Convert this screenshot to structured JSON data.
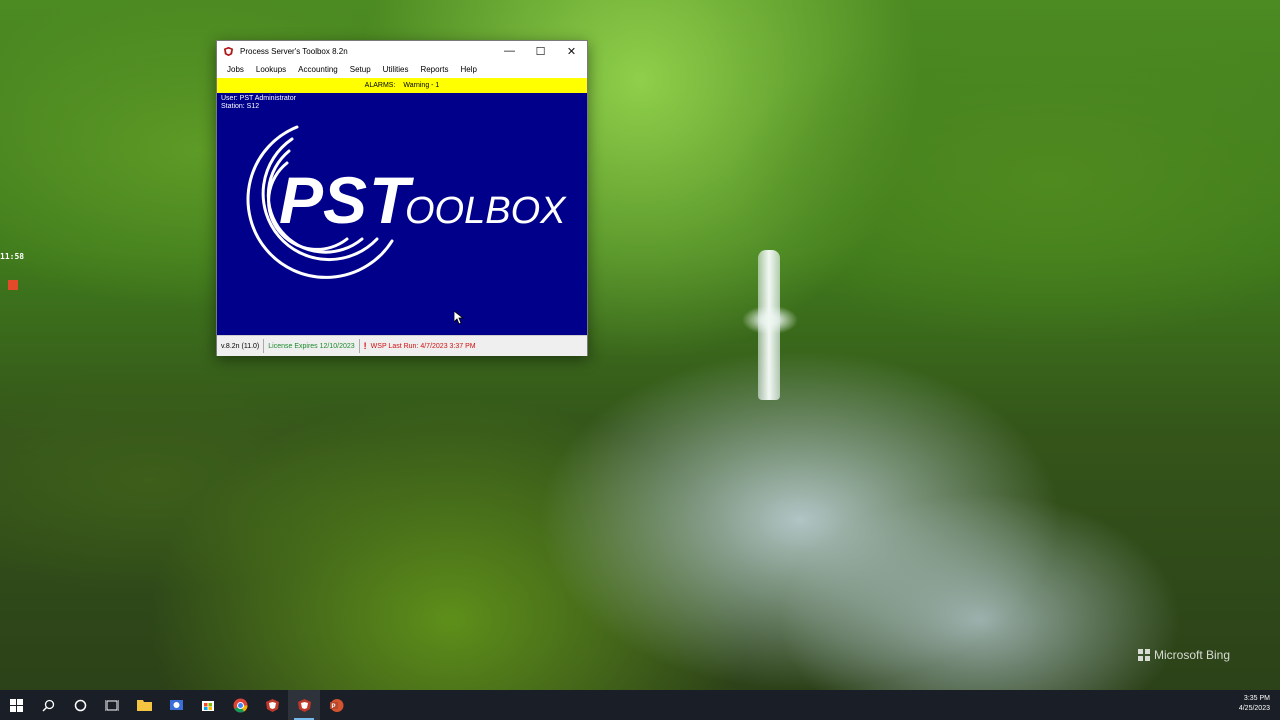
{
  "desktop": {
    "side_clock": "11:58",
    "wallpaper_credit": "Microsoft Bing"
  },
  "window": {
    "title": "Process Server's Toolbox 8.2n",
    "controls": {
      "minimize": "—",
      "maximize": "☐",
      "close": "✕"
    },
    "menu": [
      "Jobs",
      "Lookups",
      "Accounting",
      "Setup",
      "Utilities",
      "Reports",
      "Help"
    ],
    "alarms_label": "ALARMS:",
    "alarms_value": "Warning - 1",
    "user_line": "User: PST Administrator",
    "station_line": "Station: S12",
    "logo_ps": "PS",
    "logo_t": "T",
    "logo_rest": "OOLBOX",
    "status": {
      "version": "v.8.2n (11.0)",
      "license": "License Expires 12/10/2023",
      "wsp_icon": "!",
      "wsp": "WSP Last Run: 4/7/2023 3:37 PM"
    }
  },
  "taskbar": {
    "icons": [
      "windows-start-icon",
      "search-icon",
      "cortana-icon",
      "task-view-icon",
      "file-explorer-icon",
      "app-icon",
      "store-icon",
      "chrome-icon",
      "pst-icon",
      "pst-toolbox-active-icon",
      "powerpoint-icon"
    ],
    "time": "3:35 PM",
    "date": "4/25/2023"
  },
  "colors": {
    "main_bg": "#00008b",
    "alarm_bg": "#ffff00",
    "license_green": "#1b8a2c",
    "wsp_red": "#d01010"
  }
}
